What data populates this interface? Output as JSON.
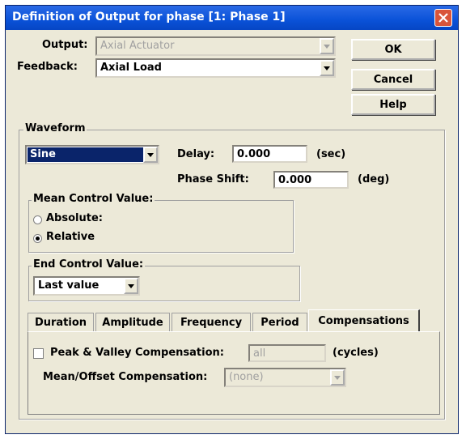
{
  "window": {
    "title": "Definition of Output for phase [1: Phase 1]"
  },
  "output": {
    "label": "Output:",
    "value": "Axial Actuator"
  },
  "feedback": {
    "label": "Feedback:",
    "value": "Axial Load"
  },
  "buttons": {
    "ok": "OK",
    "cancel": "Cancel",
    "help": "Help"
  },
  "waveform": {
    "legend": "Waveform",
    "type": "Sine",
    "delay_label": "Delay:",
    "delay_value": "0.000",
    "delay_unit": "(sec)",
    "phase_label": "Phase Shift:",
    "phase_value": "0.000",
    "phase_unit": "(deg)"
  },
  "mean_control": {
    "legend": "Mean Control Value:",
    "options": [
      "Absolute:",
      "Relative"
    ],
    "selected": "Relative"
  },
  "end_control": {
    "legend": "End Control Value:",
    "value": "Last value"
  },
  "tabs": {
    "items": [
      "Duration",
      "Amplitude",
      "Frequency",
      "Period",
      "Compensations"
    ],
    "active": "Compensations"
  },
  "compensations": {
    "peak_label": "Peak & Valley Compensation:",
    "peak_checked": false,
    "peak_value": "all",
    "peak_unit": "(cycles)",
    "mean_label": "Mean/Offset Compensation:",
    "mean_value": "(none)"
  },
  "colors": {
    "titlebar": "#0a52d8",
    "dialog_bg": "#ece9d8",
    "selection": "#0a246a",
    "close_button": "#d9553a"
  },
  "icons": {
    "close": "close-icon",
    "dropdown": "chevron-down-icon"
  }
}
